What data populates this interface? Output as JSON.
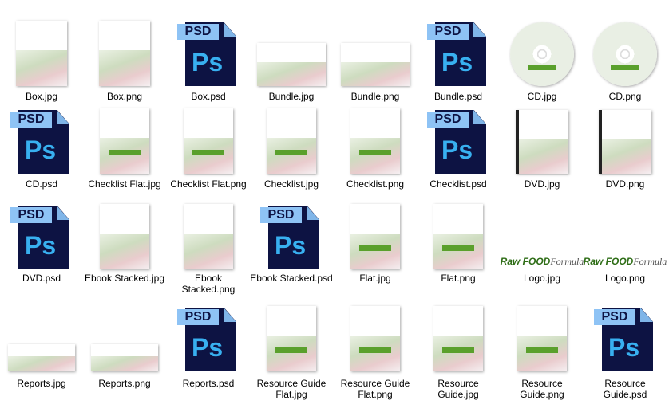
{
  "files": [
    {
      "name": "Box.jpg",
      "kind": "box"
    },
    {
      "name": "Box.png",
      "kind": "box"
    },
    {
      "name": "Box.psd",
      "kind": "psd"
    },
    {
      "name": "Bundle.jpg",
      "kind": "bundle"
    },
    {
      "name": "Bundle.png",
      "kind": "bundle"
    },
    {
      "name": "Bundle.psd",
      "kind": "psd"
    },
    {
      "name": "CD.jpg",
      "kind": "cd"
    },
    {
      "name": "CD.png",
      "kind": "cd"
    },
    {
      "name": "CD.psd",
      "kind": "psd"
    },
    {
      "name": "Checklist Flat.jpg",
      "kind": "flat"
    },
    {
      "name": "Checklist Flat.png",
      "kind": "flat"
    },
    {
      "name": "Checklist.jpg",
      "kind": "flat"
    },
    {
      "name": "Checklist.png",
      "kind": "flat"
    },
    {
      "name": "Checklist.psd",
      "kind": "psd"
    },
    {
      "name": "DVD.jpg",
      "kind": "dvd"
    },
    {
      "name": "DVD.png",
      "kind": "dvd"
    },
    {
      "name": "DVD.psd",
      "kind": "psd"
    },
    {
      "name": "Ebook Stacked.jpg",
      "kind": "stack"
    },
    {
      "name": "Ebook Stacked.png",
      "kind": "stack"
    },
    {
      "name": "Ebook Stacked.psd",
      "kind": "psd"
    },
    {
      "name": "Flat.jpg",
      "kind": "flat"
    },
    {
      "name": "Flat.png",
      "kind": "flat"
    },
    {
      "name": "Logo.jpg",
      "kind": "logo"
    },
    {
      "name": "Logo.png",
      "kind": "logo"
    },
    {
      "name": "Reports.jpg",
      "kind": "reports"
    },
    {
      "name": "Reports.png",
      "kind": "reports"
    },
    {
      "name": "Reports.psd",
      "kind": "psd"
    },
    {
      "name": "Resource Guide Flat.jpg",
      "kind": "flat"
    },
    {
      "name": "Resource Guide Flat.png",
      "kind": "flat"
    },
    {
      "name": "Resource Guide.jpg",
      "kind": "flat"
    },
    {
      "name": "Resource Guide.png",
      "kind": "flat"
    },
    {
      "name": "Resource Guide.psd",
      "kind": "psd"
    }
  ],
  "psd_icon": {
    "tag": "PSD",
    "glyph": "Ps",
    "page_color": "#0d1343",
    "tag_color": "#8ec3f5",
    "glyph_color": "#38b0f0"
  },
  "logo_text": {
    "raw": "Raw",
    "food": "FOOD",
    "formula": "Formula"
  },
  "accent_color": "#5aa02c"
}
